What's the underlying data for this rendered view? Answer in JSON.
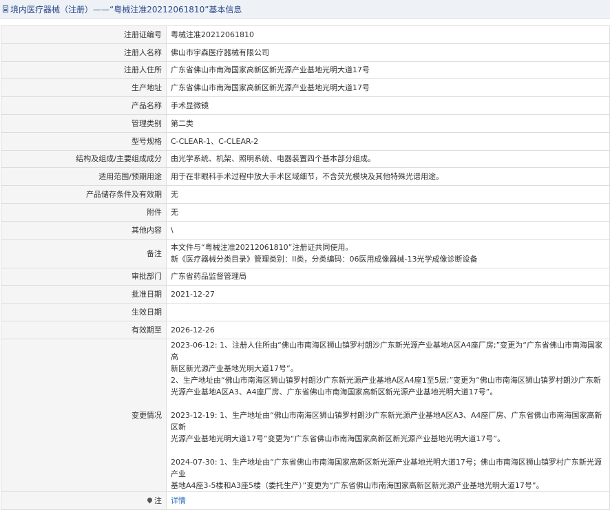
{
  "header": {
    "title": "境内医疗器械（注册）——“粤械注准20212061810”基本信息"
  },
  "rows": [
    {
      "label": "注册证编号",
      "value": "粤械注准20212061810"
    },
    {
      "label": "注册人名称",
      "value": "佛山市宇森医疗器械有限公司"
    },
    {
      "label": "注册人住所",
      "value": "广东省佛山市南海国家高新区新光源产业基地光明大道17号"
    },
    {
      "label": "生产地址",
      "value": "广东省佛山市南海国家高新区新光源产业基地光明大道17号"
    },
    {
      "label": "产品名称",
      "value": "手术显微镜"
    },
    {
      "label": "管理类别",
      "value": "第二类"
    },
    {
      "label": "型号规格",
      "value": "C-CLEAR-1、C-CLEAR-2"
    },
    {
      "label": "结构及组成/主要组成成分",
      "value": "由光学系统、机架、照明系统、电器装置四个基本部分组成。"
    },
    {
      "label": "适用范围/预期用途",
      "value": "用于在非眼科手术过程中放大手术区域细节，不含荧光模块及其他特殊光谱用途。"
    },
    {
      "label": "产品储存条件及有效期",
      "value": "无"
    },
    {
      "label": "附件",
      "value": "无"
    },
    {
      "label": "其他内容",
      "value": "\\"
    }
  ],
  "remark": {
    "label": "备注",
    "lines": [
      "本文件与“粤械注准20212061810”注册证共同使用。",
      "新《医疗器械分类目录》管理类别：II类，分类编码：06医用成像器械-13光学成像诊断设备"
    ]
  },
  "rows2": [
    {
      "label": "审批部门",
      "value": "广东省药品监督管理局"
    },
    {
      "label": "批准日期",
      "value": "2021-12-27"
    },
    {
      "label": "生效日期",
      "value": ""
    },
    {
      "label": "有效期至",
      "value": "2026-12-26"
    }
  ],
  "changes": {
    "label": "变更情况",
    "lines": [
      "2023-06-12: 1、注册人住所由“佛山市南海区狮山镇罗村朗沙广东新光源产业基地A区A4座厂房;”变更为“广东省佛山市南海国家高",
      "新区新光源产业基地光明大道17号”。",
      "2、生产地址由“佛山市南海区狮山镇罗村朗沙广东新光源产业基地A区A4座1至5层;”变更为“佛山市南海区狮山镇罗村朗沙广东新",
      "光源产业基地A区A3、A4座厂房、广东省佛山市南海国家高新区新光源产业基地光明大道17号”。",
      "",
      "2023-12-19: 1、生产地址由“佛山市南海区狮山镇罗村朗沙广东新光源产业基地A区A3、A4座厂房、广东省佛山市南海国家高新区新",
      "光源产业基地光明大道17号”变更为“广东省佛山市南海国家高新区新光源产业基地光明大道17号”。",
      "",
      "2024-07-30: 1、生产地址由“广东省佛山市南海国家高新区新光源产业基地光明大道17号；佛山市南海区狮山镇罗村广东新光源产业",
      "基地A4座3-5楼和A3座5楼（委托生产）”变更为“广东省佛山市南海国家高新区新光源产业基地光明大道17号”。"
    ]
  },
  "note": {
    "label": "注",
    "link": "详情"
  }
}
